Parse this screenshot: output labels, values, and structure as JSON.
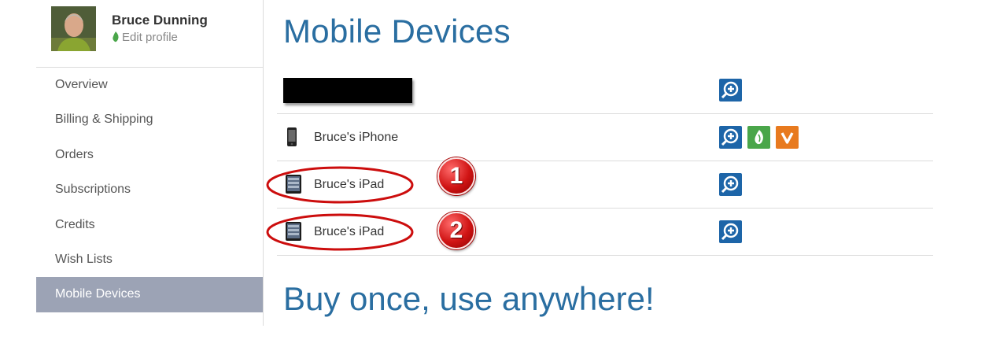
{
  "profile": {
    "name": "Bruce Dunning",
    "edit_label": "Edit profile"
  },
  "sidebar": {
    "items": [
      {
        "label": "Overview",
        "active": false
      },
      {
        "label": "Billing & Shipping",
        "active": false
      },
      {
        "label": "Orders",
        "active": false
      },
      {
        "label": "Subscriptions",
        "active": false
      },
      {
        "label": "Credits",
        "active": false
      },
      {
        "label": "Wish Lists",
        "active": false
      },
      {
        "label": "Mobile Devices",
        "active": true
      }
    ]
  },
  "main": {
    "title": "Mobile Devices",
    "devices": [
      {
        "name": "",
        "redacted": true,
        "icon": "none",
        "apps": [
          "logos-icon"
        ]
      },
      {
        "name": "Bruce's iPhone",
        "icon": "iphone-icon",
        "apps": [
          "logos-icon",
          "faithlife-icon",
          "vyrso-icon"
        ]
      },
      {
        "name": "Bruce's iPad",
        "icon": "ipad-icon",
        "apps": [
          "logos-icon"
        ],
        "callout": "1"
      },
      {
        "name": "Bruce's iPad",
        "icon": "ipad-icon",
        "apps": [
          "logos-icon"
        ],
        "callout": "2"
      }
    ],
    "section_heading": "Buy once, use anywhere!"
  },
  "colors": {
    "accent": "#2a6ea1",
    "active_nav": "#9ca3b5",
    "logos_blue": "#1d65a8",
    "faithlife_green": "#4aa64a",
    "vyrso_orange": "#e87a1e",
    "callout_red": "#d01414"
  }
}
